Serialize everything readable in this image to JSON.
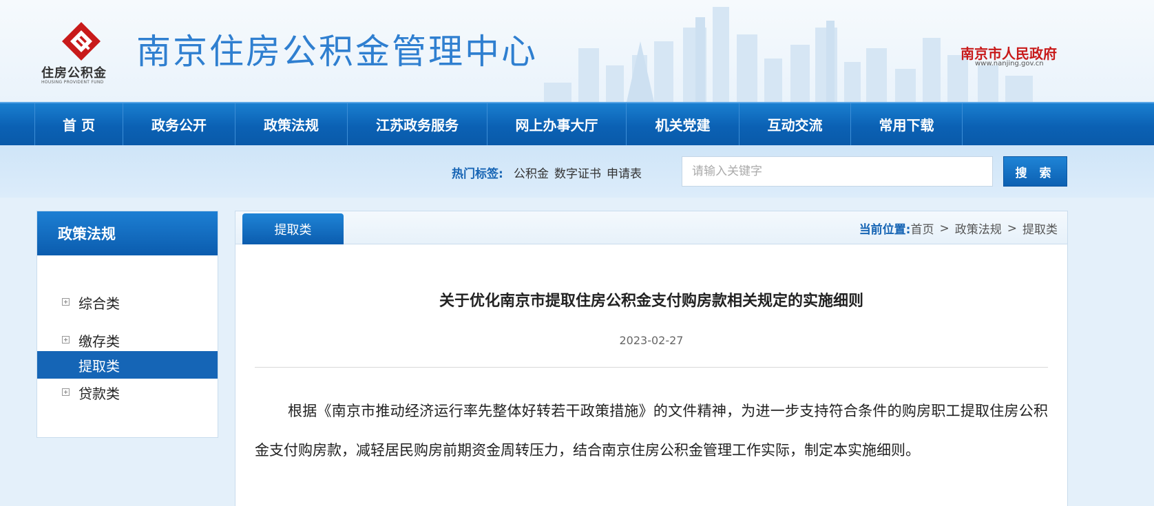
{
  "header": {
    "logo_text": "住房公积金",
    "logo_sub": "HOUSING PROVIDENT FUND",
    "site_title": "南京住房公积金管理中心",
    "gov_name": "南京市人民政府",
    "gov_url": "www.nanjing.gov.cn",
    "colors": {
      "title": "#2f7fd0",
      "logo": "#c81a1a",
      "gov": "#c81a1a"
    }
  },
  "nav": {
    "items": [
      {
        "label": "首 页"
      },
      {
        "label": "政务公开"
      },
      {
        "label": "政策法规"
      },
      {
        "label": "江苏政务服务"
      },
      {
        "label": "网上办事大厅"
      },
      {
        "label": "机关党建"
      },
      {
        "label": "互动交流"
      },
      {
        "label": "常用下载"
      }
    ],
    "colors": {
      "background": "#0b61b4"
    }
  },
  "search": {
    "hot_label": "热门标签:",
    "hot_tags": [
      "公积金",
      "数字证书",
      "申请表"
    ],
    "placeholder": "请输入关键字",
    "value": "",
    "button_label": "搜 索"
  },
  "sidebar": {
    "heading": "政策法规",
    "items": [
      {
        "label": "综合类",
        "icon": "plus-box-icon",
        "active": false
      },
      {
        "label": "缴存类",
        "icon": "plus-box-icon",
        "active": false
      },
      {
        "label": "提取类",
        "icon": "",
        "active": true
      },
      {
        "label": "贷款类",
        "icon": "plus-box-icon",
        "active": false
      }
    ]
  },
  "content": {
    "tab_label": "提取类",
    "breadcrumb": {
      "label": "当前位置:",
      "items": [
        "首页",
        "政策法规",
        "提取类"
      ],
      "separator": ">"
    },
    "article": {
      "title": "关于优化南京市提取住房公积金支付购房款相关规定的实施细则",
      "date": "2023-02-27",
      "body": "根据《南京市推动经济运行率先整体好转若干政策措施》的文件精神，为进一步支持符合条件的购房职工提取住房公积金支付购房款，减轻居民购房前期资金周转压力，结合南京住房公积金管理工作实际，制定本实施细则。"
    }
  }
}
